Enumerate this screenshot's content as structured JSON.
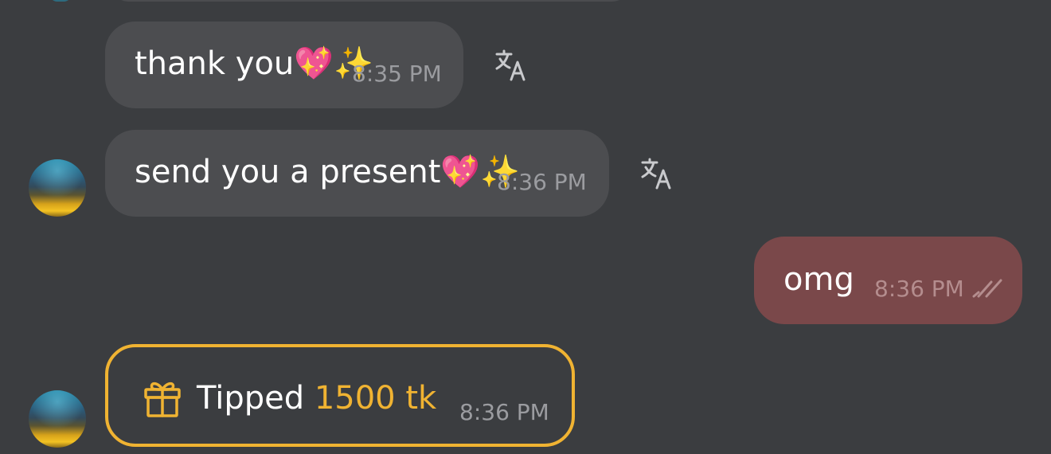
{
  "messages": [
    {
      "text": "thank you",
      "emoji": "💖✨",
      "time": "8:35 PM"
    },
    {
      "text": "send you a present",
      "emoji": "💖✨",
      "time": "8:36 PM"
    },
    {
      "text": "omg",
      "time": "8:36 PM"
    }
  ],
  "tip": {
    "label": "Tipped",
    "amount": "1500 tk",
    "time": "8:36 PM"
  },
  "icons": {
    "translate": "translate-icon",
    "read_receipt": "double-check-icon",
    "gift": "gift-icon"
  },
  "colors": {
    "background": "#3b3d40",
    "incoming_bubble": "#4c4d50",
    "outgoing_bubble": "#7a484a",
    "tip_accent": "#f0b332",
    "timestamp": "#9b9ca0"
  }
}
